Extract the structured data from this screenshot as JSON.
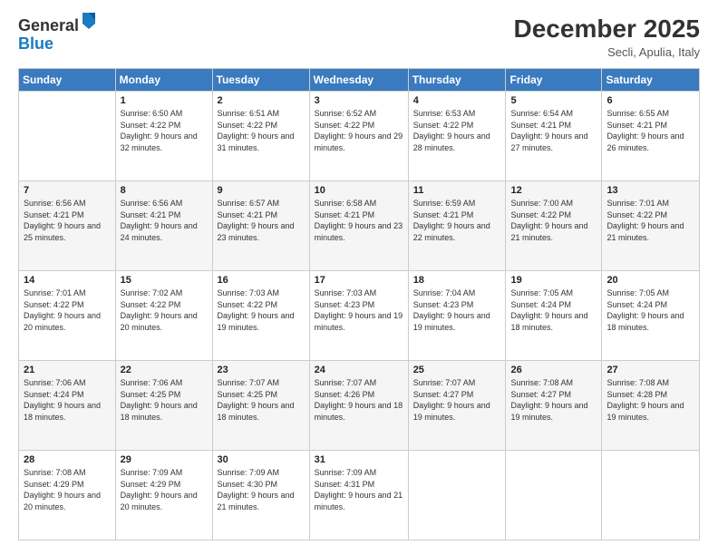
{
  "logo": {
    "general": "General",
    "blue": "Blue"
  },
  "header": {
    "month": "December 2025",
    "location": "Secli, Apulia, Italy"
  },
  "weekdays": [
    "Sunday",
    "Monday",
    "Tuesday",
    "Wednesday",
    "Thursday",
    "Friday",
    "Saturday"
  ],
  "weeks": [
    [
      {
        "day": "",
        "sunrise": "",
        "sunset": "",
        "daylight": ""
      },
      {
        "day": "1",
        "sunrise": "Sunrise: 6:50 AM",
        "sunset": "Sunset: 4:22 PM",
        "daylight": "Daylight: 9 hours and 32 minutes."
      },
      {
        "day": "2",
        "sunrise": "Sunrise: 6:51 AM",
        "sunset": "Sunset: 4:22 PM",
        "daylight": "Daylight: 9 hours and 31 minutes."
      },
      {
        "day": "3",
        "sunrise": "Sunrise: 6:52 AM",
        "sunset": "Sunset: 4:22 PM",
        "daylight": "Daylight: 9 hours and 29 minutes."
      },
      {
        "day": "4",
        "sunrise": "Sunrise: 6:53 AM",
        "sunset": "Sunset: 4:22 PM",
        "daylight": "Daylight: 9 hours and 28 minutes."
      },
      {
        "day": "5",
        "sunrise": "Sunrise: 6:54 AM",
        "sunset": "Sunset: 4:21 PM",
        "daylight": "Daylight: 9 hours and 27 minutes."
      },
      {
        "day": "6",
        "sunrise": "Sunrise: 6:55 AM",
        "sunset": "Sunset: 4:21 PM",
        "daylight": "Daylight: 9 hours and 26 minutes."
      }
    ],
    [
      {
        "day": "7",
        "sunrise": "Sunrise: 6:56 AM",
        "sunset": "Sunset: 4:21 PM",
        "daylight": "Daylight: 9 hours and 25 minutes."
      },
      {
        "day": "8",
        "sunrise": "Sunrise: 6:56 AM",
        "sunset": "Sunset: 4:21 PM",
        "daylight": "Daylight: 9 hours and 24 minutes."
      },
      {
        "day": "9",
        "sunrise": "Sunrise: 6:57 AM",
        "sunset": "Sunset: 4:21 PM",
        "daylight": "Daylight: 9 hours and 23 minutes."
      },
      {
        "day": "10",
        "sunrise": "Sunrise: 6:58 AM",
        "sunset": "Sunset: 4:21 PM",
        "daylight": "Daylight: 9 hours and 23 minutes."
      },
      {
        "day": "11",
        "sunrise": "Sunrise: 6:59 AM",
        "sunset": "Sunset: 4:21 PM",
        "daylight": "Daylight: 9 hours and 22 minutes."
      },
      {
        "day": "12",
        "sunrise": "Sunrise: 7:00 AM",
        "sunset": "Sunset: 4:22 PM",
        "daylight": "Daylight: 9 hours and 21 minutes."
      },
      {
        "day": "13",
        "sunrise": "Sunrise: 7:01 AM",
        "sunset": "Sunset: 4:22 PM",
        "daylight": "Daylight: 9 hours and 21 minutes."
      }
    ],
    [
      {
        "day": "14",
        "sunrise": "Sunrise: 7:01 AM",
        "sunset": "Sunset: 4:22 PM",
        "daylight": "Daylight: 9 hours and 20 minutes."
      },
      {
        "day": "15",
        "sunrise": "Sunrise: 7:02 AM",
        "sunset": "Sunset: 4:22 PM",
        "daylight": "Daylight: 9 hours and 20 minutes."
      },
      {
        "day": "16",
        "sunrise": "Sunrise: 7:03 AM",
        "sunset": "Sunset: 4:22 PM",
        "daylight": "Daylight: 9 hours and 19 minutes."
      },
      {
        "day": "17",
        "sunrise": "Sunrise: 7:03 AM",
        "sunset": "Sunset: 4:23 PM",
        "daylight": "Daylight: 9 hours and 19 minutes."
      },
      {
        "day": "18",
        "sunrise": "Sunrise: 7:04 AM",
        "sunset": "Sunset: 4:23 PM",
        "daylight": "Daylight: 9 hours and 19 minutes."
      },
      {
        "day": "19",
        "sunrise": "Sunrise: 7:05 AM",
        "sunset": "Sunset: 4:24 PM",
        "daylight": "Daylight: 9 hours and 18 minutes."
      },
      {
        "day": "20",
        "sunrise": "Sunrise: 7:05 AM",
        "sunset": "Sunset: 4:24 PM",
        "daylight": "Daylight: 9 hours and 18 minutes."
      }
    ],
    [
      {
        "day": "21",
        "sunrise": "Sunrise: 7:06 AM",
        "sunset": "Sunset: 4:24 PM",
        "daylight": "Daylight: 9 hours and 18 minutes."
      },
      {
        "day": "22",
        "sunrise": "Sunrise: 7:06 AM",
        "sunset": "Sunset: 4:25 PM",
        "daylight": "Daylight: 9 hours and 18 minutes."
      },
      {
        "day": "23",
        "sunrise": "Sunrise: 7:07 AM",
        "sunset": "Sunset: 4:25 PM",
        "daylight": "Daylight: 9 hours and 18 minutes."
      },
      {
        "day": "24",
        "sunrise": "Sunrise: 7:07 AM",
        "sunset": "Sunset: 4:26 PM",
        "daylight": "Daylight: 9 hours and 18 minutes."
      },
      {
        "day": "25",
        "sunrise": "Sunrise: 7:07 AM",
        "sunset": "Sunset: 4:27 PM",
        "daylight": "Daylight: 9 hours and 19 minutes."
      },
      {
        "day": "26",
        "sunrise": "Sunrise: 7:08 AM",
        "sunset": "Sunset: 4:27 PM",
        "daylight": "Daylight: 9 hours and 19 minutes."
      },
      {
        "day": "27",
        "sunrise": "Sunrise: 7:08 AM",
        "sunset": "Sunset: 4:28 PM",
        "daylight": "Daylight: 9 hours and 19 minutes."
      }
    ],
    [
      {
        "day": "28",
        "sunrise": "Sunrise: 7:08 AM",
        "sunset": "Sunset: 4:29 PM",
        "daylight": "Daylight: 9 hours and 20 minutes."
      },
      {
        "day": "29",
        "sunrise": "Sunrise: 7:09 AM",
        "sunset": "Sunset: 4:29 PM",
        "daylight": "Daylight: 9 hours and 20 minutes."
      },
      {
        "day": "30",
        "sunrise": "Sunrise: 7:09 AM",
        "sunset": "Sunset: 4:30 PM",
        "daylight": "Daylight: 9 hours and 21 minutes."
      },
      {
        "day": "31",
        "sunrise": "Sunrise: 7:09 AM",
        "sunset": "Sunset: 4:31 PM",
        "daylight": "Daylight: 9 hours and 21 minutes."
      },
      {
        "day": "",
        "sunrise": "",
        "sunset": "",
        "daylight": ""
      },
      {
        "day": "",
        "sunrise": "",
        "sunset": "",
        "daylight": ""
      },
      {
        "day": "",
        "sunrise": "",
        "sunset": "",
        "daylight": ""
      }
    ]
  ]
}
